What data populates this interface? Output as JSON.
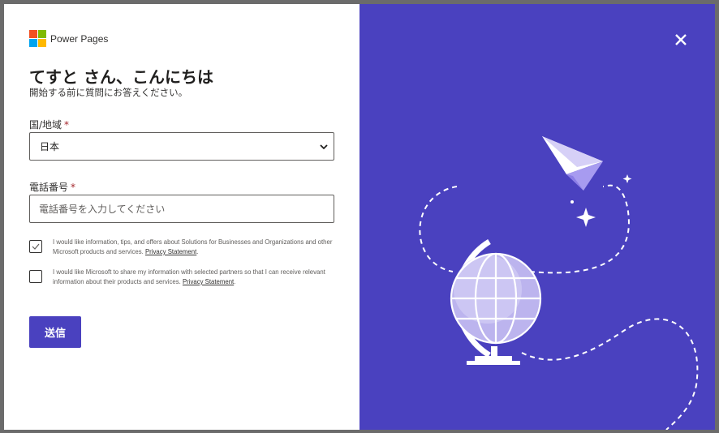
{
  "brand": {
    "name": "Power Pages",
    "logo_colors": [
      "#f25022",
      "#7fba00",
      "#00a4ef",
      "#ffb900"
    ]
  },
  "header": {
    "greeting": "てすと さん、こんにちは",
    "subtitle": "開始する前に質問にお答えください。"
  },
  "form": {
    "country": {
      "label": "国/地域",
      "required_mark": "*",
      "value": "日本"
    },
    "phone": {
      "label": "電話番号",
      "required_mark": "*",
      "placeholder": "電話番号を入力してください"
    },
    "consent1": {
      "checked": true,
      "text": "I would like information, tips, and offers about Solutions for Businesses and Organizations and other Microsoft products and services.",
      "link": "Privacy Statement",
      "suffix": "."
    },
    "consent2": {
      "checked": false,
      "text": "I would like Microsoft to share my information with selected partners so that I can receive relevant information about their products and services.",
      "link": "Privacy Statement",
      "suffix": "."
    },
    "submit_label": "送信"
  },
  "panel": {
    "background": "#4a41bf",
    "close_icon": "close-icon",
    "illustration": "globe-paper-plane-illustration"
  },
  "colors": {
    "accent": "#4a41bf",
    "required": "#a4262c"
  }
}
